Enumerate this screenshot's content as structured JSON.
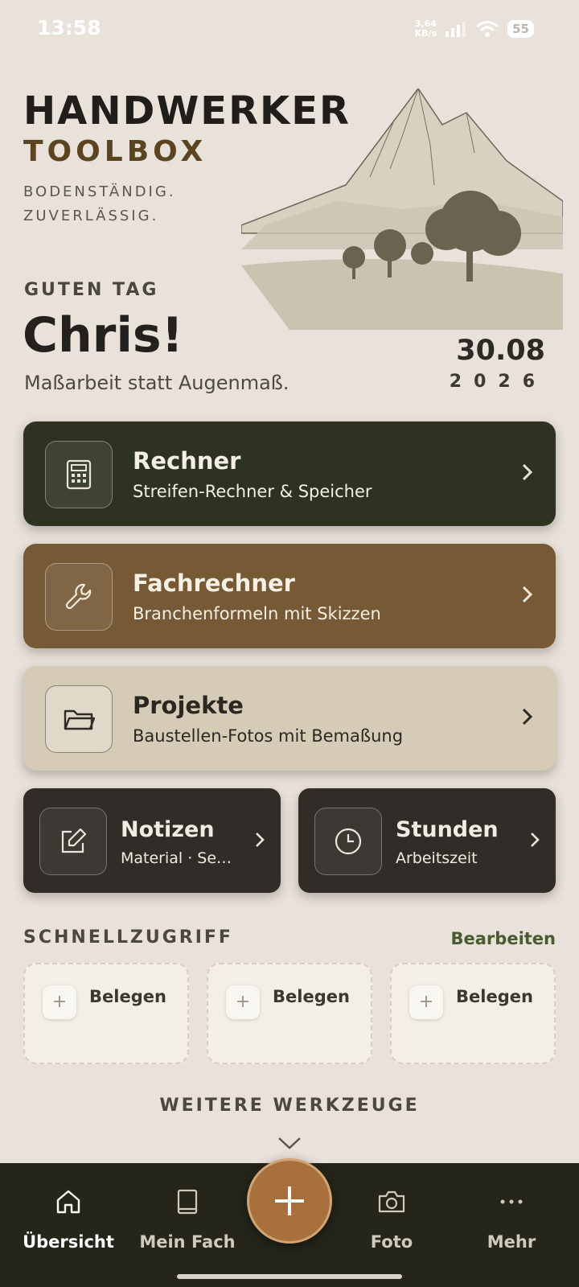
{
  "status": {
    "time": "13:58",
    "net_speed": "3,64\nKB/s",
    "battery": "55"
  },
  "brand": {
    "title": "HANDWERKER",
    "subtitle": "TOOLBOX",
    "tagline": "BODENSTÄNDIG. ZUVERLÄSSIG."
  },
  "greeting": {
    "label": "GUTEN TAG",
    "name": "Chris!",
    "tagline": "Maßarbeit statt Augenmaß."
  },
  "date": {
    "day": "30.08",
    "year": "2026"
  },
  "cards": [
    {
      "title": "Rechner",
      "subtitle": "Streifen-Rechner & Speicher",
      "icon": "calculator-icon"
    },
    {
      "title": "Fachrechner",
      "subtitle": "Branchenformeln mit Skizzen",
      "icon": "wrench-icon"
    },
    {
      "title": "Projekte",
      "subtitle": "Baustellen-Fotos mit Bemaßung",
      "icon": "folder-icon"
    }
  ],
  "small_cards": [
    {
      "title": "Notizen",
      "subtitle": "Material · Se…",
      "icon": "edit-icon"
    },
    {
      "title": "Stunden",
      "subtitle": "Arbeitszeit",
      "icon": "clock-icon"
    }
  ],
  "quick_access": {
    "heading": "SCHNELLZUGRIFF",
    "edit_label": "Bearbeiten",
    "slots": [
      {
        "label": "Belegen"
      },
      {
        "label": "Belegen"
      },
      {
        "label": "Belegen"
      }
    ]
  },
  "more_tools": "WEITERE WERKZEUGE",
  "nav": [
    {
      "label": "Übersicht",
      "icon": "home-icon",
      "active": true
    },
    {
      "label": "Mein Fach",
      "icon": "book-icon"
    },
    {
      "label": "Foto",
      "icon": "camera-icon"
    },
    {
      "label": "Mehr",
      "icon": "more-icon"
    }
  ],
  "colors": {
    "background": "#e8e2da",
    "rechner": "#2e3321",
    "fachrechner": "#765a35",
    "projekte": "#d6cbb6",
    "dark_card": "#302d28",
    "navbar": "#252619",
    "fab": "#a8703d",
    "accent_green": "#485a2e"
  }
}
